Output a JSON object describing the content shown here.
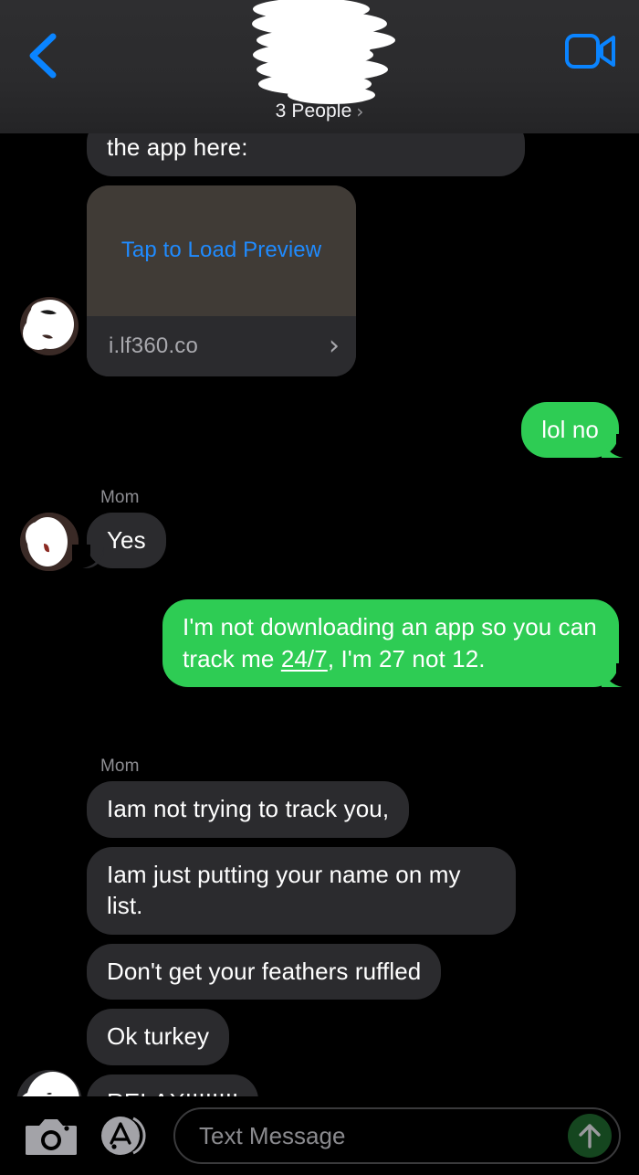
{
  "app": {
    "name": "Messages",
    "theme": "dark"
  },
  "header": {
    "back_label": "Back",
    "back_icon": "chevron-left-icon",
    "avatar_state": "redacted-scribble",
    "participants_label": "3 People",
    "participants_chevron": "›",
    "facetime_icon": "video-camera-icon"
  },
  "colors": {
    "background": "#000000",
    "header_bg": "#2c2c2e",
    "incoming_bubble": "#2b2b2e",
    "outgoing_bubble": "#2ecc54",
    "accent_blue": "#0a84ff",
    "link_blue": "#1f8bff",
    "secondary_text": "#8e8e93",
    "send_button": "#15461f",
    "preview_card_top": "#403b36"
  },
  "messages": [
    {
      "id": "m1",
      "direction": "incoming",
      "type": "text",
      "text": "the app here:",
      "clipped_by_header": true,
      "sender": null,
      "avatar": false
    },
    {
      "id": "m2",
      "direction": "incoming",
      "type": "link-preview",
      "cta": "Tap to Load Preview",
      "domain": "i.lf360.co",
      "arrow": "›",
      "sender": null,
      "avatar": true
    },
    {
      "id": "m3",
      "direction": "outgoing",
      "type": "text",
      "text": "lol no",
      "sender": null,
      "avatar": false
    },
    {
      "id": "m4",
      "direction": "incoming",
      "type": "text",
      "text": "Yes",
      "sender": "Mom",
      "avatar": true
    },
    {
      "id": "m5",
      "direction": "outgoing",
      "type": "rich-text",
      "text_before": "I'm not downloading an app so you can track me ",
      "text_link": "24/7",
      "text_after": ", I'm 27 not 12.",
      "sender": null,
      "avatar": false
    },
    {
      "id": "m6",
      "direction": "incoming",
      "type": "text",
      "text": "Iam not trying to track you,",
      "sender": "Mom",
      "avatar": false
    },
    {
      "id": "m7",
      "direction": "incoming",
      "type": "text",
      "text": "Iam just putting your name on my list.",
      "sender": null,
      "avatar": false
    },
    {
      "id": "m8",
      "direction": "incoming",
      "type": "text",
      "text": "Don't get your feathers ruffled",
      "sender": null,
      "avatar": false
    },
    {
      "id": "m9",
      "direction": "incoming",
      "type": "text",
      "text": "Ok turkey",
      "sender": null,
      "avatar": false
    },
    {
      "id": "m10",
      "direction": "incoming",
      "type": "text",
      "text": "RELAX!!!!!!!!",
      "sender": null,
      "avatar": true
    }
  ],
  "toolbar": {
    "camera_icon": "camera-icon",
    "appstore_icon": "app-store-icon",
    "input_value": "",
    "input_placeholder": "Text Message",
    "send_icon": "arrow-up-icon",
    "send_enabled": false
  }
}
